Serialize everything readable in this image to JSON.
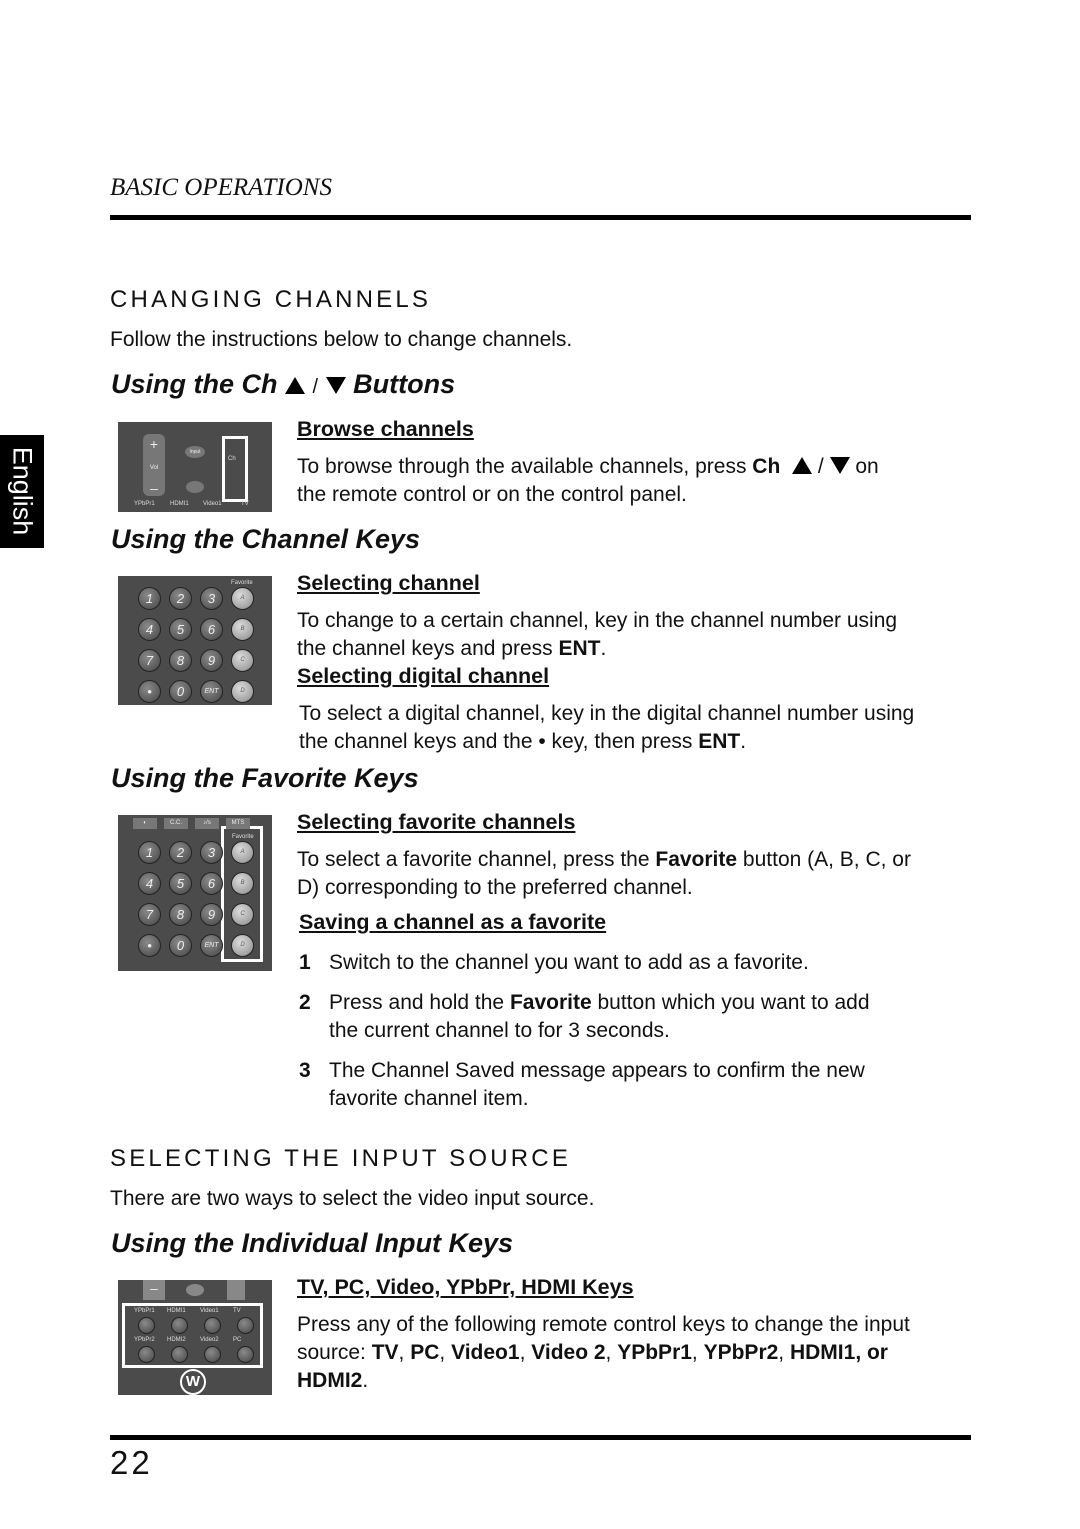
{
  "header": {
    "section": "BASIC OPERATIONS"
  },
  "side_tab": "English",
  "changing_channels": {
    "title": "CHANGING CHANNELS",
    "intro": "Follow the instructions below to change channels.",
    "ch_buttons": {
      "heading_pre": "Using the Ch",
      "heading_sep": "/",
      "heading_post": "Buttons",
      "sub": "Browse channels",
      "text_pre": "To browse through the available channels, press",
      "text_bold": "Ch",
      "text_sep": "/",
      "text_post": "on",
      "text_line2": "the remote control or on the control panel.",
      "remote_labels": {
        "vol": "Vol",
        "input": "Input",
        "ch": "Ch",
        "bottom": [
          "YPbPr1",
          "HDMI1",
          "Video1",
          "TV"
        ]
      }
    },
    "channel_keys": {
      "heading": "Using the Channel Keys",
      "sub1": "Selecting channel",
      "text1": "To change to a certain channel, key in the channel number using",
      "text1b_pre": "the channel keys and press ",
      "text1b_bold": "ENT",
      "text1b_post": ".",
      "sub2": "Selecting digital channel",
      "text2": "To select a digital channel, key in the digital channel number using",
      "text2b_pre": "the channel keys and the • key, then press ",
      "text2b_bold": "ENT",
      "text2b_post": ".",
      "remote_keys": [
        "1",
        "2",
        "3",
        "A",
        "4",
        "5",
        "6",
        "B",
        "7",
        "8",
        "9",
        "C",
        "•",
        "0",
        "ENT",
        "D"
      ],
      "favorite_label": "Favorite"
    },
    "favorite_keys": {
      "heading": "Using the Favorite Keys",
      "sub1": "Selecting favorite channels",
      "text1_pre": "To select a favorite channel, press the ",
      "text1_bold": "Favorite",
      "text1_post": " button (A, B, C, or",
      "text1b": "D) corresponding to the preferred channel.",
      "sub2": "Saving a channel as a favorite",
      "steps": [
        {
          "n": "1",
          "pre": "Switch to the channel you want to add as a favorite.",
          "bold": "",
          "post": "",
          "line2": ""
        },
        {
          "n": "2",
          "pre": "Press and hold the ",
          "bold": "Favorite",
          "post": " button which you want to add",
          "line2": "the current channel to for 3 seconds."
        },
        {
          "n": "3",
          "pre": "The Channel Saved message appears to confirm the new",
          "bold": "",
          "post": "",
          "line2": "favorite channel item."
        }
      ],
      "top_buttons": [
        "◐",
        "C.C.",
        "♪/s",
        "MTS"
      ]
    }
  },
  "input_source": {
    "title": "SELECTING THE INPUT SOURCE",
    "intro": "There are two ways to select the video input source.",
    "heading": "Using the Individual Input Keys",
    "sub": "TV, PC, Video, YPbPr, HDMI Keys",
    "text1": "Press any of the following remote control keys to change the input",
    "text2_pre": "source: ",
    "keys": [
      "TV",
      "PC",
      "Video1",
      "Video 2",
      "YPbPr1",
      "YPbPr2",
      "HDMI1"
    ],
    "or": ", or",
    "last": "HDMI2",
    "remote_labels": [
      [
        "YPbPr1",
        "HDMI1",
        "Video1",
        "TV"
      ],
      [
        "YPbPr2",
        "HDMI2",
        "Video2",
        "PC"
      ]
    ],
    "logo": "W"
  },
  "footer": {
    "page_number": "22"
  }
}
